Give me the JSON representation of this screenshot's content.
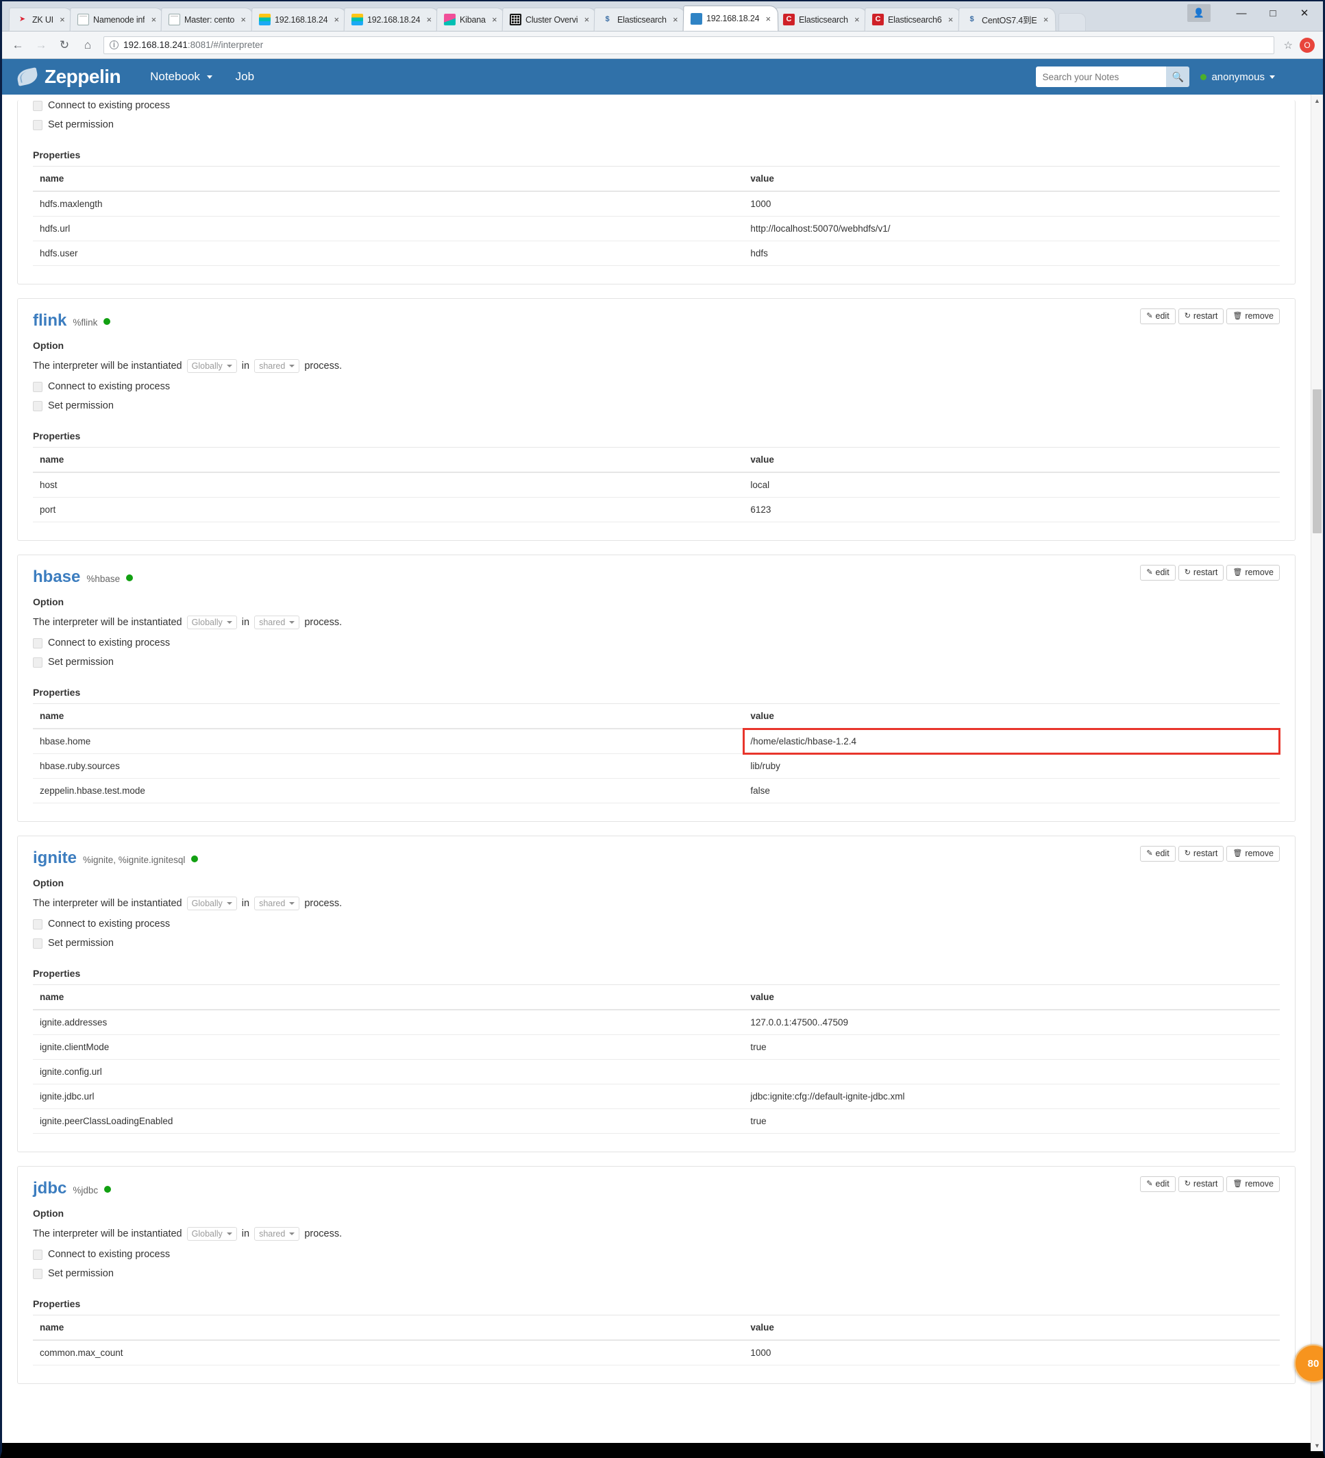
{
  "browser": {
    "tabs": [
      {
        "label": "ZK UI",
        "favicon": "zookeeper-icon",
        "active": false
      },
      {
        "label": "Namenode inf",
        "favicon": "page-icon",
        "active": false
      },
      {
        "label": "Master: cento",
        "favicon": "page-icon",
        "active": false
      },
      {
        "label": "192.168.18.24",
        "favicon": "elastic-icon",
        "active": false
      },
      {
        "label": "192.168.18.24",
        "favicon": "elastic-icon",
        "active": false
      },
      {
        "label": "Kibana",
        "favicon": "kibana-icon",
        "active": false
      },
      {
        "label": "Cluster Overvi",
        "favicon": "grid-icon",
        "active": false
      },
      {
        "label": "Elasticsearch",
        "favicon": "es-glyph-icon",
        "active": false
      },
      {
        "label": "192.168.18.24",
        "favicon": "zeppelin-icon",
        "active": true
      },
      {
        "label": "Elasticsearch",
        "favicon": "c-red-icon",
        "active": false
      },
      {
        "label": "Elasticsearch6",
        "favicon": "c-red-icon",
        "active": false
      },
      {
        "label": "CentOS7.4到E",
        "favicon": "es-glyph-icon",
        "active": false
      }
    ],
    "close_glyph": "×",
    "nav": {
      "back": "←",
      "forward": "→",
      "reload": "↻",
      "home": "⌂"
    },
    "url_prefix": "192.168.18.241",
    "url_suffix": ":8081/#/interpreter",
    "info_glyph": "i",
    "star_glyph": "☆",
    "extension_label": "O",
    "window_controls": {
      "minimize": "—",
      "maximize": "□",
      "close": "✕",
      "profile": "●"
    }
  },
  "app": {
    "brand": "Zeppelin",
    "nav_items": [
      {
        "label": "Notebook",
        "has_caret": true
      },
      {
        "label": "Job",
        "has_caret": false
      }
    ],
    "search_placeholder": "Search your Notes",
    "search_value": "",
    "search_icon": "search-icon",
    "user": "anonymous"
  },
  "labels": {
    "option": "Option",
    "properties": "Properties",
    "instantiate_prefix": "The interpreter will be instantiated",
    "instantiate_mid": "in",
    "instantiate_suffix": "process.",
    "scope_value": "Globally",
    "process_value": "shared",
    "connect_existing": "Connect to existing process",
    "set_permission": "Set permission",
    "col_name": "name",
    "col_value": "value",
    "btn_edit": "edit",
    "btn_restart": "restart",
    "btn_remove": "remove",
    "icon_edit": "pencil-icon",
    "icon_restart": "refresh-icon",
    "icon_remove": "trash-icon"
  },
  "interpreters": [
    {
      "id": "hdfs",
      "name": "",
      "alias": "",
      "clipped": true,
      "properties": [
        {
          "name": "hdfs.maxlength",
          "value": "1000"
        },
        {
          "name": "hdfs.url",
          "value": "http://localhost:50070/webhdfs/v1/"
        },
        {
          "name": "hdfs.user",
          "value": "hdfs"
        }
      ]
    },
    {
      "id": "flink",
      "name": "flink",
      "alias": "%flink",
      "clipped": false,
      "properties": [
        {
          "name": "host",
          "value": "local"
        },
        {
          "name": "port",
          "value": "6123"
        }
      ]
    },
    {
      "id": "hbase",
      "name": "hbase",
      "alias": "%hbase",
      "clipped": false,
      "properties": [
        {
          "name": "hbase.home",
          "value": "/home/elastic/hbase-1.2.4",
          "highlight": true
        },
        {
          "name": "hbase.ruby.sources",
          "value": "lib/ruby"
        },
        {
          "name": "zeppelin.hbase.test.mode",
          "value": "false"
        }
      ]
    },
    {
      "id": "ignite",
      "name": "ignite",
      "alias": "%ignite, %ignite.ignitesql",
      "clipped": false,
      "properties": [
        {
          "name": "ignite.addresses",
          "value": "127.0.0.1:47500..47509"
        },
        {
          "name": "ignite.clientMode",
          "value": "true"
        },
        {
          "name": "ignite.config.url",
          "value": ""
        },
        {
          "name": "ignite.jdbc.url",
          "value": "jdbc:ignite:cfg://default-ignite-jdbc.xml"
        },
        {
          "name": "ignite.peerClassLoadingEnabled",
          "value": "true"
        }
      ]
    },
    {
      "id": "jdbc",
      "name": "jdbc",
      "alias": "%jdbc",
      "clipped": false,
      "properties": [
        {
          "name": "common.max_count",
          "value": "1000"
        }
      ]
    }
  ],
  "overlay_badge": "80",
  "colors": {
    "navbar": "#3071a9",
    "interpreter_name": "#3c7dbf",
    "status_dot": "#12a012",
    "highlight": "#e8352c",
    "badge": "#f7941e"
  }
}
